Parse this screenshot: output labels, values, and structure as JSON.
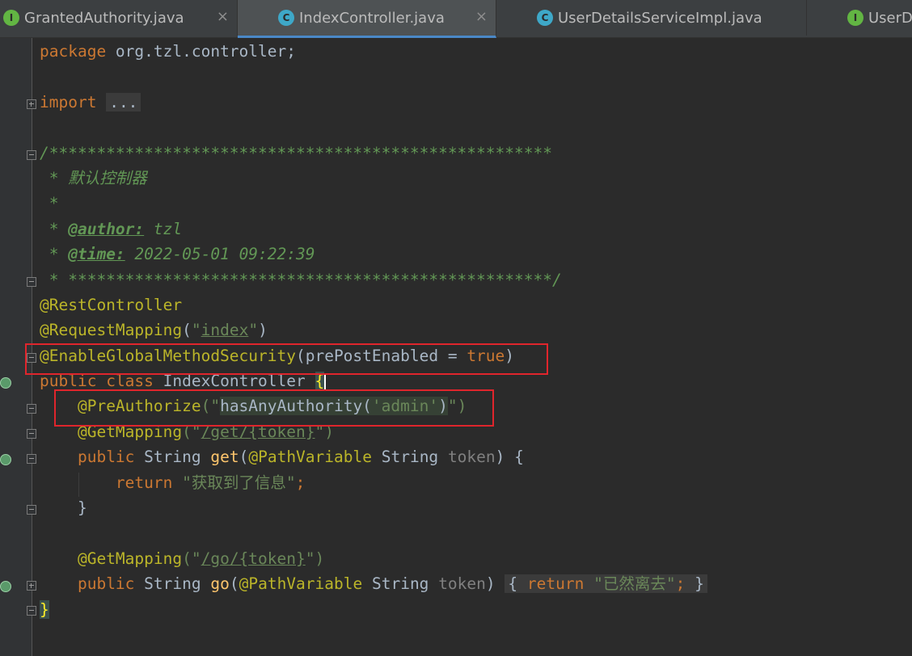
{
  "tabs": [
    {
      "label": "GrantedAuthority.java",
      "icon": "I",
      "icon_type": "interface",
      "active": false
    },
    {
      "label": "IndexController.java",
      "icon": "C",
      "icon_type": "class",
      "active": true
    },
    {
      "label": "UserDetailsServiceImpl.java",
      "icon": "C",
      "icon_type": "class",
      "active": false
    },
    {
      "label": "UserD",
      "icon": "I",
      "icon_type": "interface",
      "active": false
    }
  ],
  "tab_close_glyph": "×",
  "code": {
    "l1": {
      "kw": "package",
      "rest": " org.tzl.controller;"
    },
    "l2": {
      "kw": "import",
      "folded": "..."
    },
    "l3": {
      "comment": "/*****************************************************"
    },
    "l4": {
      "comment": " * 默认控制器"
    },
    "l5": {
      "comment": " *"
    },
    "l6": {
      "prefix": " * ",
      "tag": "@author:",
      "value": " tzl"
    },
    "l7": {
      "prefix": " * ",
      "tag": "@time:",
      "value": " 2022-05-01 09:22:39"
    },
    "l8": {
      "comment": " * ***************************************************/"
    },
    "l9": {
      "ann": "@RestController"
    },
    "l10": {
      "ann": "@RequestMapping",
      "open": "(",
      "q1": "\"",
      "str": "index",
      "q2": "\"",
      "close": ")"
    },
    "l11": {
      "ann": "@EnableGlobalMethodSecurity",
      "args": "(prePostEnabled = ",
      "val": "true",
      "close": ")"
    },
    "l12": {
      "kw1": "public",
      "kw2": "class",
      "name": "IndexController",
      "brace": "{"
    },
    "l13": {
      "ann": "@PreAuthorize",
      "open": "(\"",
      "expr1": "hasAnyAuthority(",
      "str": "'admin'",
      "expr2": ")",
      "close": "\")"
    },
    "l14": {
      "ann": "@GetMapping",
      "open": "(\"",
      "path": "/get/{token}",
      "close": "\")"
    },
    "l15": {
      "kw": "public",
      "type": "String",
      "fn": "get",
      "open": "(",
      "ann": "@PathVariable",
      "ptype": "String",
      "param": "token",
      "close": ") {"
    },
    "l16": {
      "kw": "return",
      "str": "\"获取到了信息\"",
      "semi": ";"
    },
    "l17": {
      "brace": "}"
    },
    "l18": {
      "ann": "@GetMapping",
      "open": "(\"",
      "path": "/go/{token}",
      "close": "\")"
    },
    "l19": {
      "kw": "public",
      "type": "String",
      "fn": "go",
      "open": "(",
      "ann": "@PathVariable",
      "ptype": "String",
      "param": "token",
      "close": ")",
      "ob": "{",
      "ret": "return",
      "str": "\"已然离去\"",
      "semi": ";",
      "cb": "}"
    },
    "l20": {
      "brace": "}"
    }
  },
  "colors": {
    "keyword": "#cc7832",
    "annotation": "#bbb529",
    "string": "#6a8759",
    "comment": "#629755",
    "highlight_box": "#e0252c"
  }
}
